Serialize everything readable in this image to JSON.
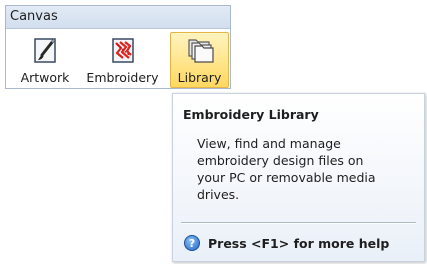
{
  "ribbon": {
    "group_title": "Canvas",
    "buttons": [
      {
        "label": "Artwork",
        "icon": "artwork-brush-icon"
      },
      {
        "label": "Embroidery",
        "icon": "embroidery-stitch-icon"
      },
      {
        "label": "Library",
        "icon": "library-folders-icon",
        "state": "hovered"
      }
    ]
  },
  "tooltip": {
    "title": "Embroidery Library",
    "body_lines": [
      "View, find and manage",
      "embroidery design files on",
      "your PC or removable media",
      "drives."
    ],
    "help_text": "Press <F1> for more help",
    "help_icon": "help-question-icon"
  },
  "colors": {
    "hover_gradient_top": "#fff4c0",
    "hover_gradient_bottom": "#ffd860",
    "header_blue": "#dbe5f2",
    "embroidery_red": "#e0201c"
  }
}
